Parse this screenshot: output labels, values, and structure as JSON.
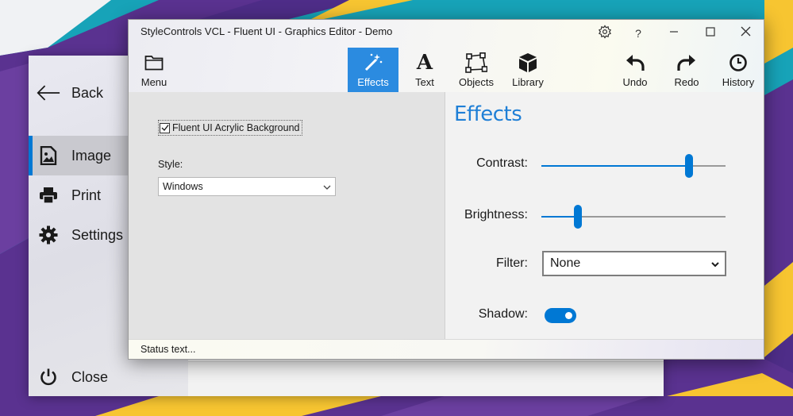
{
  "window": {
    "title": "StyleControls VCL - Fluent UI - Graphics Editor - Demo"
  },
  "toolbar": {
    "items": [
      {
        "label": "Menu",
        "icon": "folder-icon"
      },
      {
        "label": "Effects",
        "icon": "magic-wand-icon",
        "active": true
      },
      {
        "label": "Text",
        "icon": "text-icon"
      },
      {
        "label": "Objects",
        "icon": "objects-icon"
      },
      {
        "label": "Library",
        "icon": "box-icon"
      },
      {
        "label": "Undo",
        "icon": "undo-icon"
      },
      {
        "label": "Redo",
        "icon": "redo-icon"
      },
      {
        "label": "History",
        "icon": "clock-icon"
      }
    ]
  },
  "left_panel": {
    "acrylic_checkbox": {
      "label": "Fluent UI Acrylic Background",
      "checked": true
    },
    "style_label": "Style:",
    "style_value": "Windows"
  },
  "effects": {
    "title": "Effects",
    "contrast_label": "Contrast:",
    "contrast_level": 0.8,
    "brightness_label": "Brightness:",
    "brightness_level": 0.2,
    "filter_label": "Filter:",
    "filter_value": "None",
    "shadow_label": "Shadow:",
    "shadow_on": true
  },
  "status": {
    "text": "Status text..."
  },
  "nav": {
    "back_label": "Back",
    "items": [
      {
        "label": "Image",
        "icon": "image-icon",
        "active": true
      },
      {
        "label": "Print",
        "icon": "printer-icon"
      },
      {
        "label": "Settings",
        "icon": "gear-icon"
      }
    ],
    "close_label": "Close"
  },
  "colors": {
    "accent": "#0078d4",
    "title_accent": "#1f7fd6",
    "desktop_teal": "#17a3b8",
    "desktop_purple": "#54318f",
    "desktop_yellow": "#f7c531"
  }
}
